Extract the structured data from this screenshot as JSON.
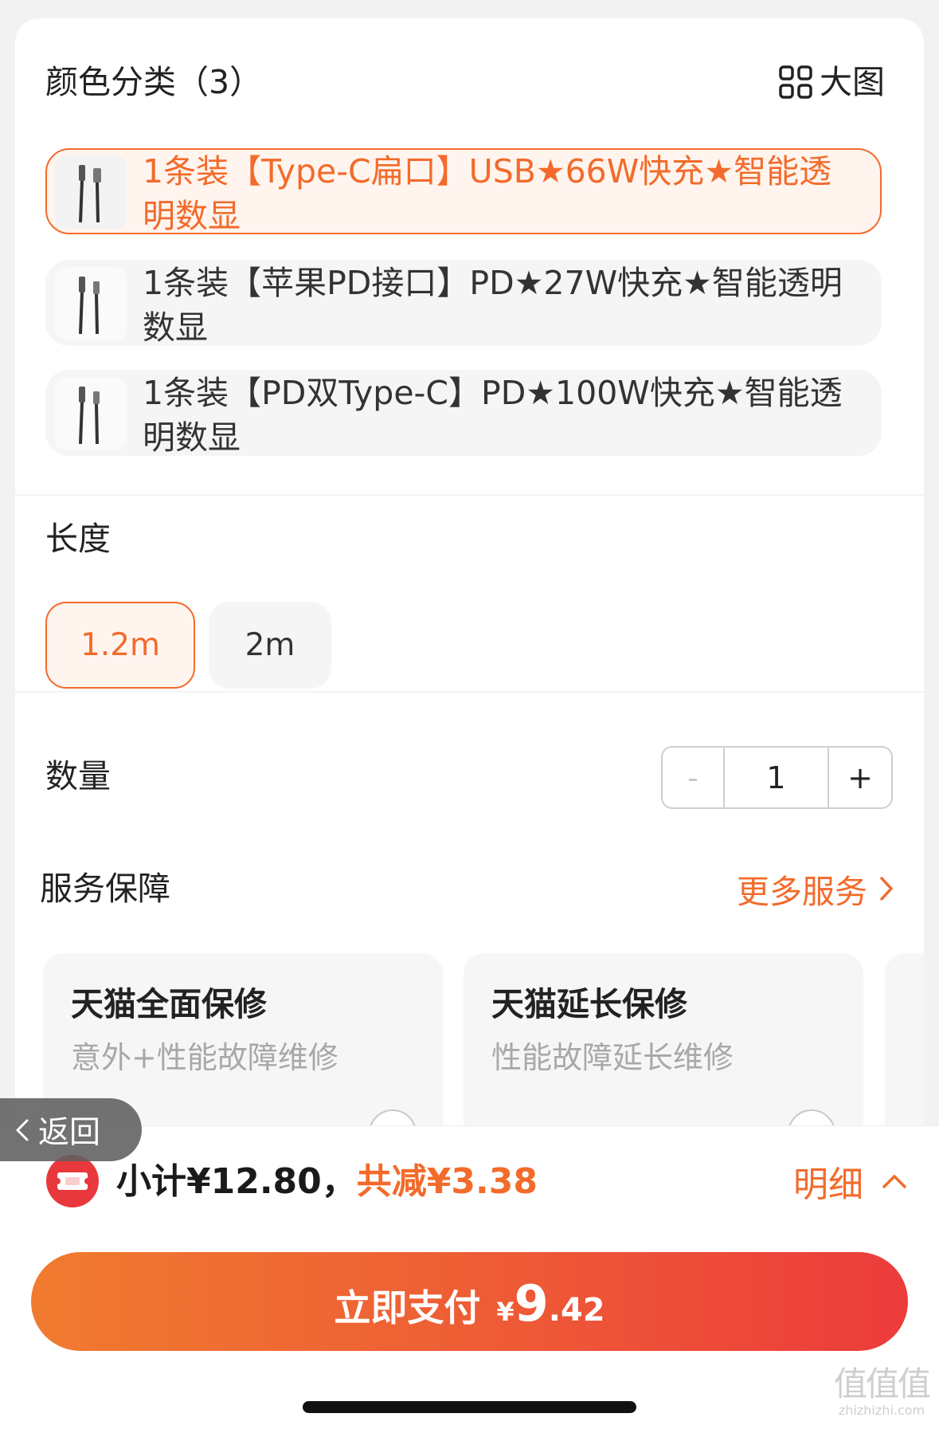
{
  "color_section": {
    "title": "颜色分类（3）",
    "big_image_label": "大图",
    "options": [
      {
        "label": "1条装【Type-C扁口】USB★66W快充★智能透明数显",
        "selected": true
      },
      {
        "label": "1条装【苹果PD接口】PD★27W快充★智能透明数显",
        "selected": false
      },
      {
        "label": "1条装【PD双Type-C】PD★100W快充★智能透明数显",
        "selected": false
      }
    ]
  },
  "length_section": {
    "title": "长度",
    "options": [
      {
        "label": "1.2m",
        "selected": true
      },
      {
        "label": "2m",
        "selected": false
      }
    ]
  },
  "quantity_section": {
    "title": "数量",
    "decrement": "-",
    "value": "1",
    "increment": "+"
  },
  "service_section": {
    "title": "服务保障",
    "more_label": "更多服务",
    "cards": [
      {
        "title": "天猫全面保修",
        "subtitle": "意外+性能故障维修"
      },
      {
        "title": "天猫延长保修",
        "subtitle": "性能故障延长维修"
      }
    ]
  },
  "back_button": {
    "label": "返回"
  },
  "summary": {
    "subtotal": "小计¥12.80，",
    "discount": "共减¥3.38",
    "detail_label": "明细"
  },
  "pay_button": {
    "label": "立即支付",
    "currency": "¥",
    "amount_int": "9",
    "amount_dec": ".42"
  },
  "watermark": {
    "glyphs": "值值值",
    "site": "zhizhizhi.com"
  },
  "colors": {
    "accent": "#f26b2b",
    "selected_bg": "#fff4ee",
    "pay_gradient_start": "#f07b2f",
    "pay_gradient_end": "#ec3b3b",
    "coupon_red": "#e8383d"
  },
  "icons": {
    "big_image": "grid-icon",
    "more": "chevron-right-icon",
    "back": "chevron-left-icon",
    "detail": "chevron-up-icon",
    "coupon": "coupon-icon"
  }
}
